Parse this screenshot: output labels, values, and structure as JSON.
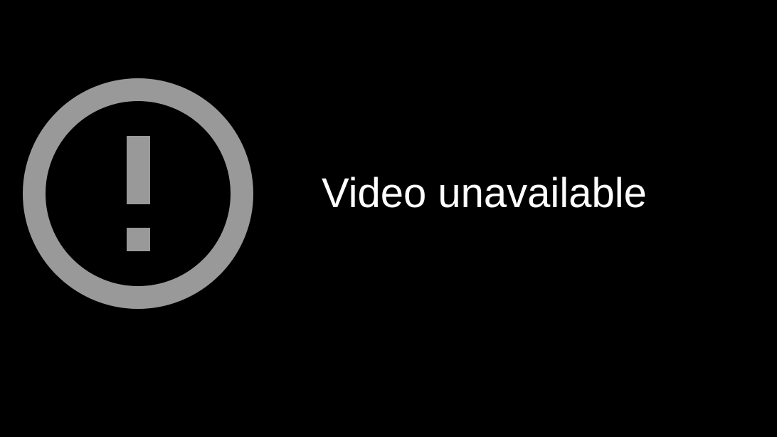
{
  "player": {
    "error_icon": "exclamation-circle-icon",
    "error_message": "Video unavailable"
  },
  "colors": {
    "background": "#000000",
    "icon": "#999999",
    "text": "#ffffff"
  }
}
